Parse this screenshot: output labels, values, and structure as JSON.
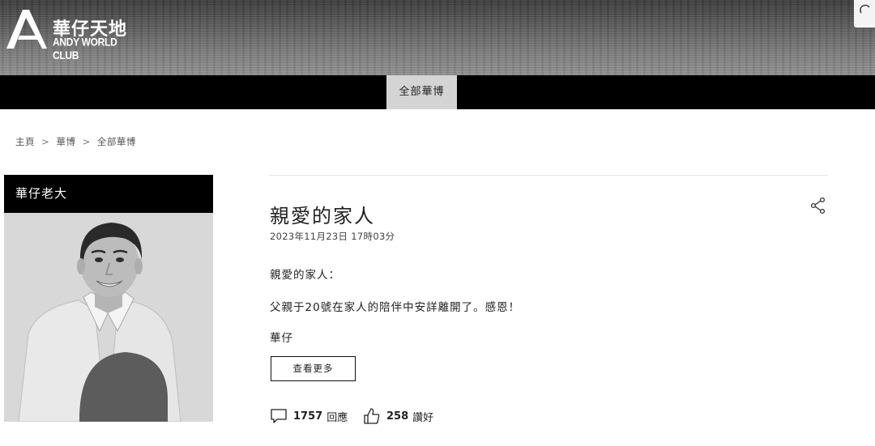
{
  "header": {
    "logo_cn": "華仔天地",
    "logo_en": "ANDY WORLD CLUB"
  },
  "nav": {
    "active_tab": "全部華博"
  },
  "breadcrumb": {
    "home": "主頁",
    "section": "華博",
    "current": "全部華博",
    "separator": ">"
  },
  "profile": {
    "name": "華仔老大"
  },
  "post": {
    "title": "親愛的家人",
    "date": "2023年11月23日 17時03分",
    "lines": [
      "親愛的家人：",
      "父親于20號在家人的陪伴中安詳離開了。感恩！",
      "華仔"
    ],
    "more_label": "查看更多",
    "comments_count": "1757",
    "comments_label": "回應",
    "likes_count": "258",
    "likes_label": "讚好"
  },
  "icons": {
    "share": "share-icon",
    "comment": "comment-icon",
    "like": "thumbs-up-icon"
  },
  "colors": {
    "nav_bg": "#000000",
    "active_tab_bg": "#d4d4d4",
    "profile_bar_bg": "#000000"
  }
}
